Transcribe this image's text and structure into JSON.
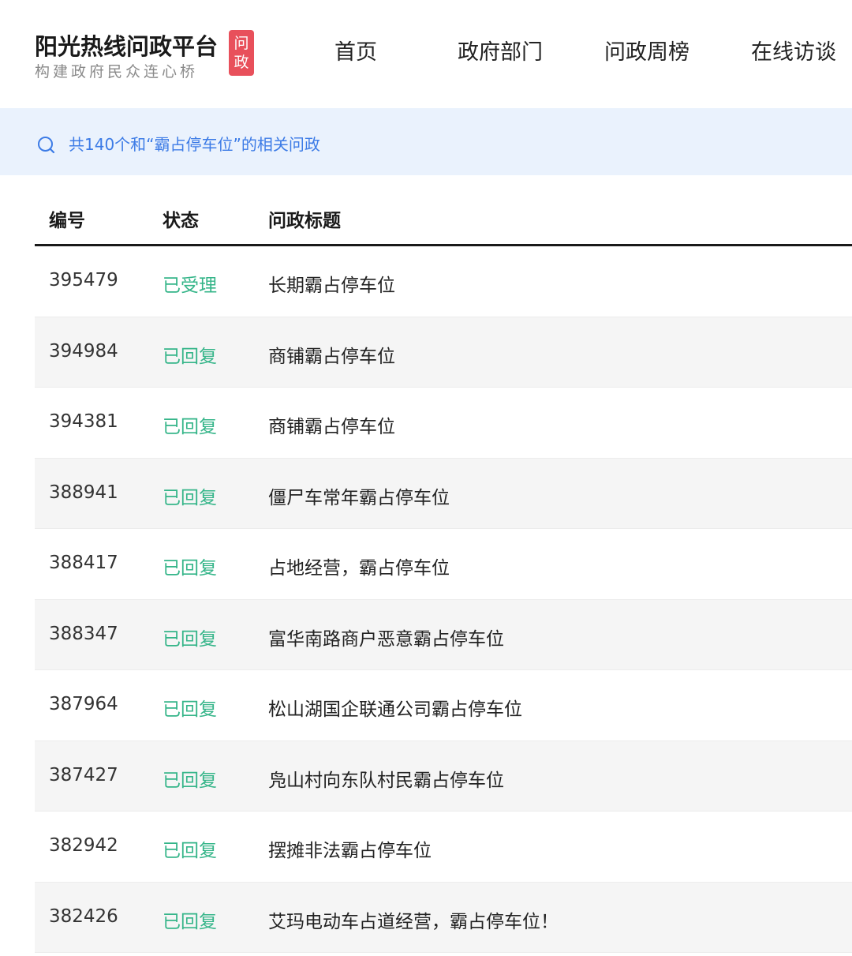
{
  "header": {
    "logo_title": "阳光热线问政平台",
    "logo_subtitle": "构建政府民众连心桥",
    "logo_badge_top": "问",
    "logo_badge_bottom": "政",
    "nav": [
      "首页",
      "政府部门",
      "问政周榜",
      "在线访谈"
    ]
  },
  "search_result": {
    "text": "共140个和“霸占停车位”的相关问政",
    "icon": "search-icon"
  },
  "table": {
    "headers": {
      "id": "编号",
      "status": "状态",
      "title": "问政标题"
    },
    "rows": [
      {
        "id": "395479",
        "status": "已受理",
        "title": "长期霸占停车位"
      },
      {
        "id": "394984",
        "status": "已回复",
        "title": "商铺霸占停车位"
      },
      {
        "id": "394381",
        "status": "已回复",
        "title": "商铺霸占停车位"
      },
      {
        "id": "388941",
        "status": "已回复",
        "title": "僵尸车常年霸占停车位"
      },
      {
        "id": "388417",
        "status": "已回复",
        "title": "占地经营，霸占停车位"
      },
      {
        "id": "388347",
        "status": "已回复",
        "title": "富华南路商户恶意霸占停车位"
      },
      {
        "id": "387964",
        "status": "已回复",
        "title": "松山湖国企联通公司霸占停车位"
      },
      {
        "id": "387427",
        "status": "已回复",
        "title": "凫山村向东队村民霸占停车位"
      },
      {
        "id": "382942",
        "status": "已回复",
        "title": "摆摊非法霸占停车位"
      },
      {
        "id": "382426",
        "status": "已回复",
        "title": "艾玛电动车占道经营，霸占停车位！"
      }
    ]
  },
  "colors": {
    "accent_blue": "#3c7be6",
    "status_green": "#35b589",
    "badge_red": "#e8505b",
    "result_bar_bg": "#eaf2fd"
  }
}
